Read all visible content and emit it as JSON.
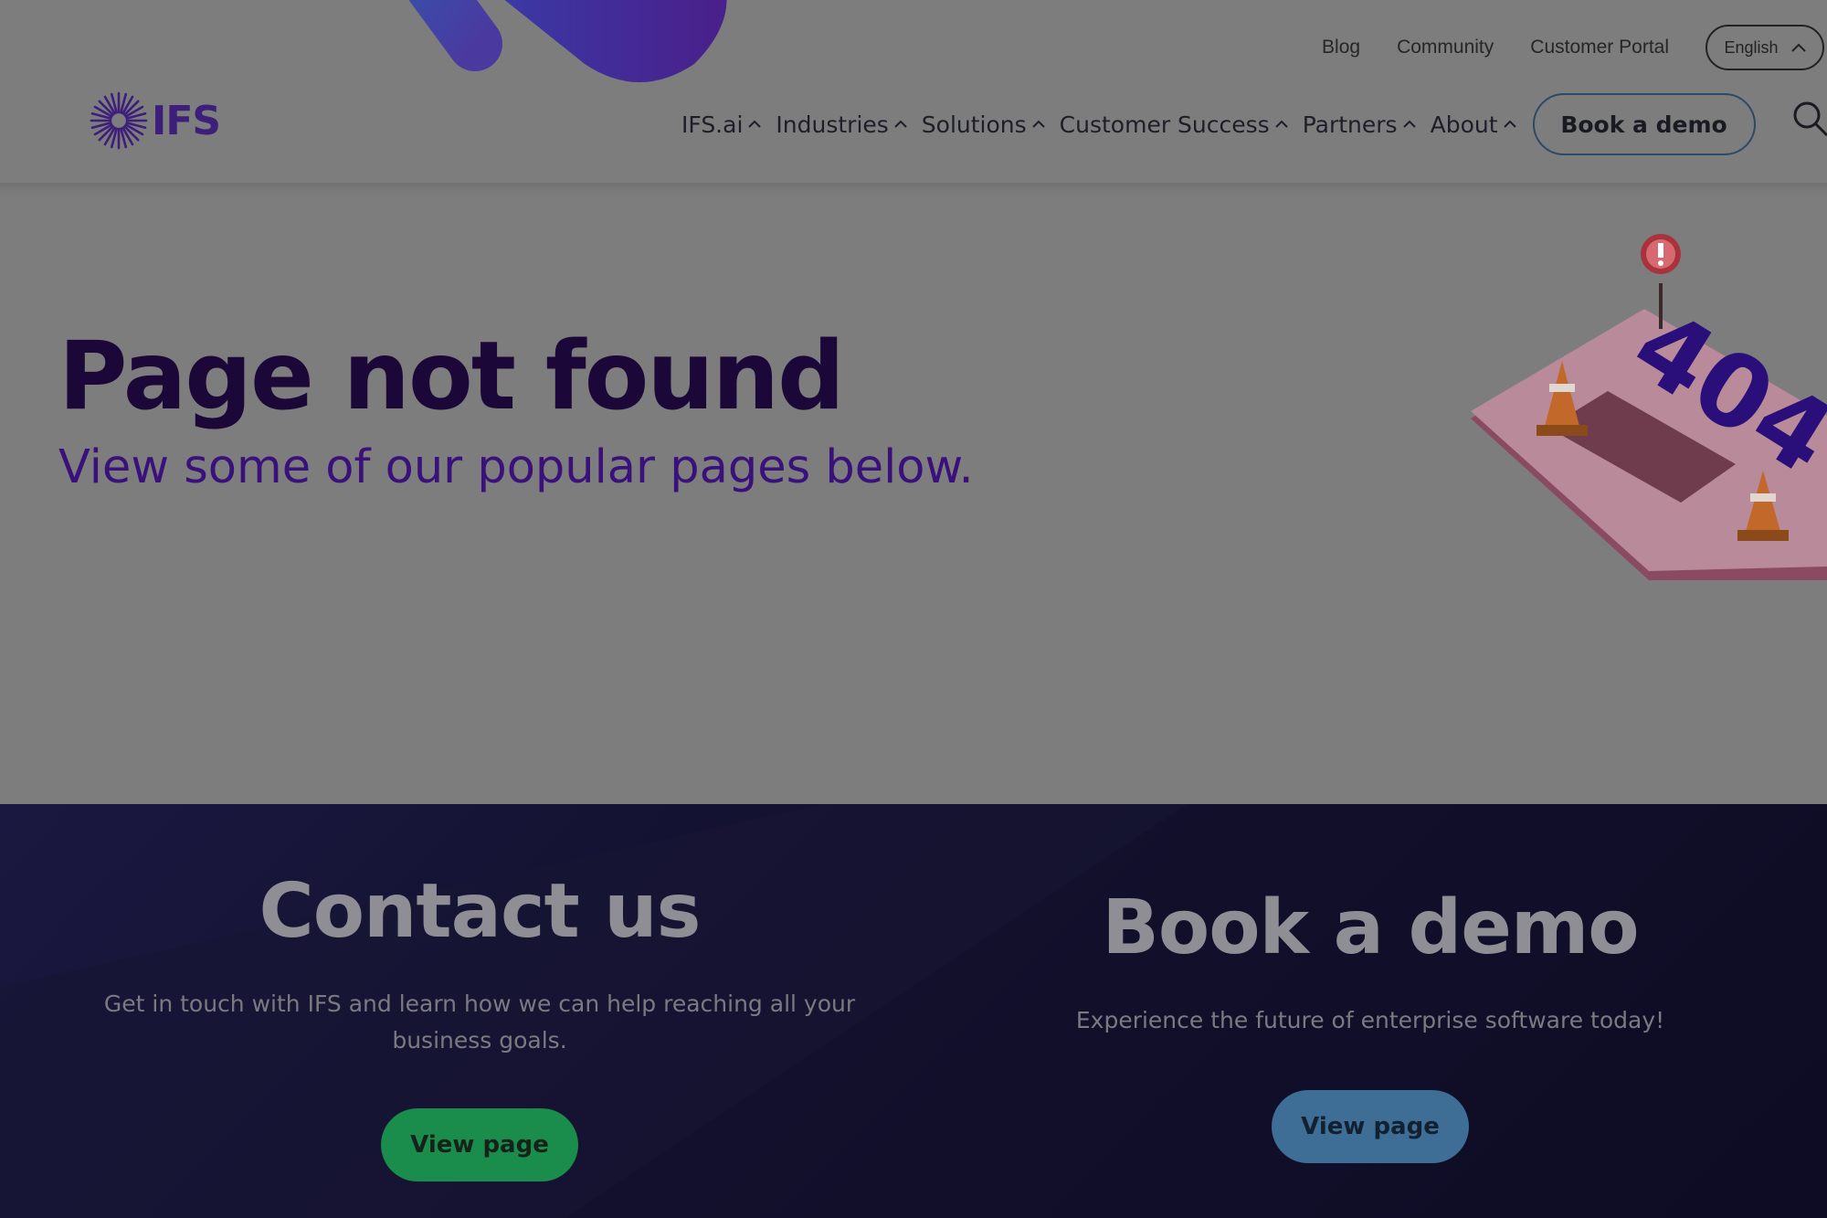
{
  "utility_nav": {
    "links": [
      "Blog",
      "Community",
      "Customer Portal"
    ],
    "language": "English"
  },
  "logo": {
    "text": "IFS"
  },
  "main_nav": {
    "items": [
      "IFS.ai",
      "Industries",
      "Solutions",
      "Customer Success",
      "Partners",
      "About"
    ],
    "cta": "Book a demo"
  },
  "hero": {
    "title": "Page not found",
    "subtitle": "View some of our popular pages below."
  },
  "cards": [
    {
      "title": "Contact us",
      "text": "Get in touch with IFS and learn how we can help reaching all your business goals.",
      "button": "View page"
    },
    {
      "title": "Book a demo",
      "text": "Experience the future of enterprise software today!",
      "button": "View page"
    }
  ],
  "illustration": {
    "label": "404",
    "icon": "404-illustration"
  },
  "colors": {
    "overlay": "#7d7d7d",
    "brand_purple": "#3a107a",
    "title_dark": "#1c0838",
    "green_button": "#1a8c4c",
    "blue_button": "#3e6e96"
  }
}
